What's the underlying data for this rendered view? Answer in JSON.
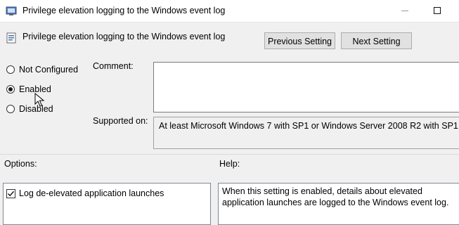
{
  "window": {
    "title": "Privilege elevation logging to the Windows event log",
    "icons": {
      "app": "policy-setting-icon",
      "minimize": "minimize-icon",
      "maximize": "maximize-icon"
    }
  },
  "header": {
    "setting_name": "Privilege elevation logging to the Windows event log",
    "previous_label": "Previous Setting",
    "next_label": "Next Setting"
  },
  "state": {
    "options": [
      {
        "label": "Not Configured",
        "selected": false
      },
      {
        "label": "Enabled",
        "selected": true
      },
      {
        "label": "Disabled",
        "selected": false
      }
    ]
  },
  "comment": {
    "label": "Comment:",
    "value": ""
  },
  "supported": {
    "label": "Supported on:",
    "value": "At least Microsoft Windows 7 with SP1 or Windows Server 2008 R2 with SP1"
  },
  "options_pane": {
    "label": "Options:",
    "checkbox_label": "Log de-elevated application launches",
    "checked": true
  },
  "help_pane": {
    "label": "Help:",
    "text": "When this setting is enabled, details about elevated application launches are logged to the Windows event log."
  },
  "colors": {
    "window_bg": "#f0f0f0",
    "button_bg": "#e1e1e1",
    "border": "#adadad"
  }
}
